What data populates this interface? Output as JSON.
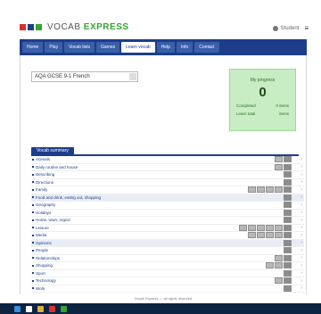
{
  "app": {
    "logo_part1": "VOCAB",
    "logo_part2": "EXPRESS",
    "user_name": "Student",
    "menu_glyph": "≡"
  },
  "colors": {
    "brand_blue": "#1b3d8c",
    "brand_green": "#36a431",
    "progress_bg": "#c8ecc3"
  },
  "nav": {
    "tabs": [
      {
        "label": "Home"
      },
      {
        "label": "Play"
      },
      {
        "label": "Vocab lists"
      },
      {
        "label": "Games"
      },
      {
        "label": "Learn vocab"
      },
      {
        "label": "Help"
      },
      {
        "label": "Info"
      },
      {
        "label": "Contact"
      }
    ],
    "active_index": 4
  },
  "course": {
    "selected": "AQA GCSE 9-1 French"
  },
  "progress": {
    "heading": "My progress",
    "score": "0",
    "left1": "Completed",
    "right1": "0 items",
    "left2": "Learn total",
    "right2": "items"
  },
  "section": {
    "title": "Vocab summary"
  },
  "list": [
    {
      "label": "Animals",
      "boxes": 2,
      "dark": [],
      "header": false
    },
    {
      "label": "Daily routine and house",
      "boxes": 2,
      "dark": [],
      "header": false
    },
    {
      "label": "Describing",
      "boxes": 1,
      "dark": [],
      "header": false
    },
    {
      "label": "Directions",
      "boxes": 1,
      "dark": [],
      "header": false
    },
    {
      "label": "Family",
      "boxes": 5,
      "dark": [],
      "header": false
    },
    {
      "label": "Food and drink, eating out, shopping",
      "boxes": 1,
      "dark": [],
      "header": true
    },
    {
      "label": "Geography",
      "boxes": 1,
      "dark": [],
      "header": false
    },
    {
      "label": "Holidays",
      "boxes": 1,
      "dark": [],
      "header": false
    },
    {
      "label": "Home, town, region",
      "boxes": 1,
      "dark": [],
      "header": false
    },
    {
      "label": "Leisure",
      "boxes": 6,
      "dark": [],
      "header": false
    },
    {
      "label": "Media",
      "boxes": 5,
      "dark": [],
      "header": false
    },
    {
      "label": "Opinions",
      "boxes": 1,
      "dark": [],
      "header": true
    },
    {
      "label": "People",
      "boxes": 1,
      "dark": [],
      "header": false
    },
    {
      "label": "Relationships",
      "boxes": 2,
      "dark": [],
      "header": false
    },
    {
      "label": "Shopping",
      "boxes": 3,
      "dark": [],
      "header": false
    },
    {
      "label": "Sport",
      "boxes": 1,
      "dark": [],
      "header": false
    },
    {
      "label": "Technology",
      "boxes": 2,
      "dark": [],
      "header": false
    },
    {
      "label": "Work",
      "boxes": 1,
      "dark": [],
      "header": false
    }
  ],
  "footer": {
    "text": "Vocab Express — all rights reserved"
  }
}
